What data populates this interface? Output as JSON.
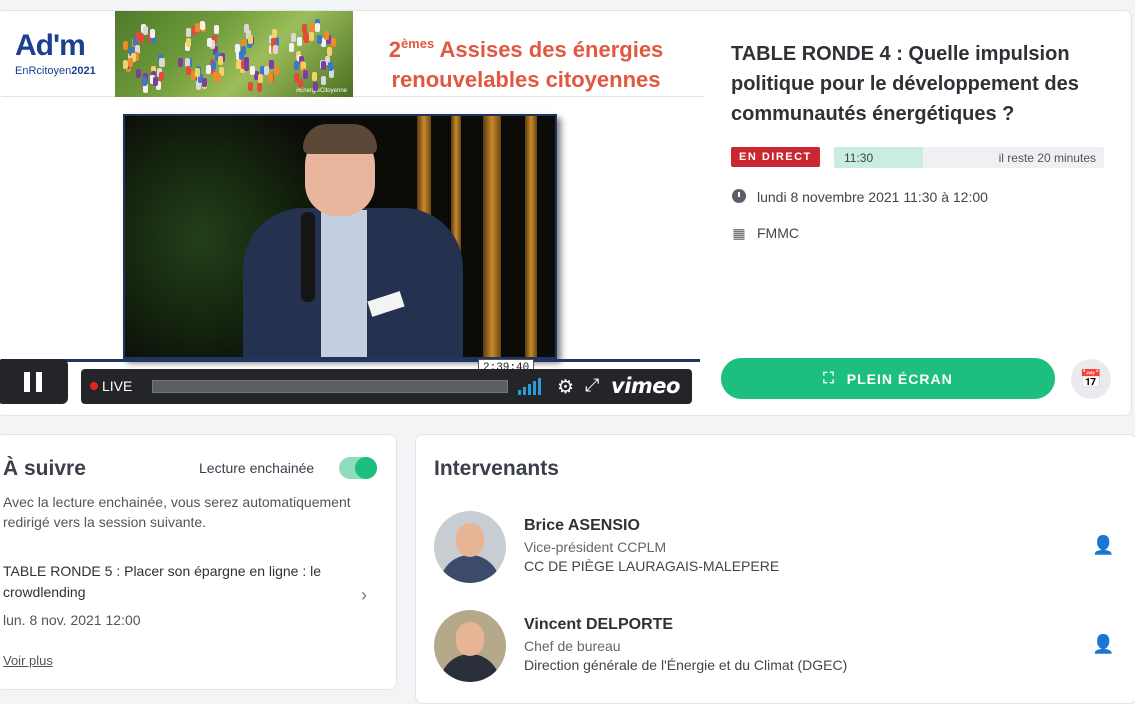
{
  "banner": {
    "logo_main": "Ad'm",
    "logo_sub_prefix": "EnRcitoyen",
    "logo_sub_year": "2021",
    "photo_tag": "#EnergieCitoyenne",
    "title_ordinal": "2",
    "title_sup": "èmes",
    "title_rest": " Assises des énergies",
    "title_line2": "renouvelables citoyennes"
  },
  "player": {
    "tooltip_time": "2:39:40",
    "live_label": "LIVE",
    "brand": "vimeo",
    "icons": [
      "pause-icon",
      "signal-bars-icon",
      "gear-icon",
      "expand-icon"
    ]
  },
  "session": {
    "title": "TABLE RONDE 4 : Quelle impulsion politique pour le développement des communautés énergétiques ?",
    "live_badge": "EN DIRECT",
    "start_time": "11:30",
    "remaining": "il reste 20 minutes",
    "elapsed_fraction": 0.33,
    "date": "lundi 8 novembre 2021 11:30 à 12:00",
    "room": "FMMC",
    "fullscreen_label": "PLEIN ÉCRAN"
  },
  "next": {
    "heading": "À suivre",
    "toggle_label": "Lecture enchainée",
    "toggle_on": true,
    "description": "Avec la lecture enchainée, vous serez automatiquement redirigé vers la session suivante.",
    "item_title": "TABLE RONDE 5 : Placer son épargne en ligne : le crowdlending",
    "item_date": "lun. 8 nov. 2021 12:00",
    "more_link": "Voir plus"
  },
  "speakers": {
    "heading": "Intervenants",
    "list": [
      {
        "name": "Brice ASENSIO",
        "role": "Vice-président CCPLM",
        "org": "CC DE PIÈGE LAURAGAIS-MALEPERE"
      },
      {
        "name": "Vincent DELPORTE",
        "role": "Chef de bureau",
        "org": "Direction générale de l'Énergie et du Climat (DGEC)"
      }
    ]
  },
  "colors": {
    "accent_green": "#1dbf7e",
    "live_red": "#c92830",
    "banner_orange": "#e2573f",
    "logo_blue": "#1b3f93"
  }
}
